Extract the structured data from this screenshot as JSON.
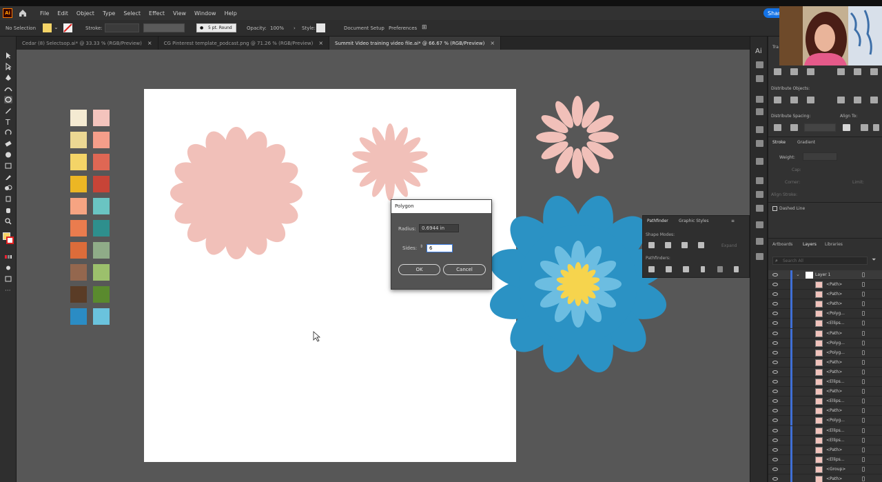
{
  "menubar": {
    "logo": "Ai",
    "items": [
      "File",
      "Edit",
      "Object",
      "Type",
      "Select",
      "Effect",
      "View",
      "Window",
      "Help"
    ],
    "share_label": "Share"
  },
  "controlbar": {
    "selection": "No Selection",
    "stroke_label": "Stroke:",
    "stroke_value": "",
    "brush": "5 pt. Round",
    "opacity_label": "Opacity:",
    "opacity_value": "100%",
    "style_label": "Style:",
    "document_setup": "Document Setup",
    "preferences": "Preferences",
    "fill_color": "#f4d467",
    "stroke_color": "#d8d8d8"
  },
  "tabs": [
    {
      "label": "Cedar (8) Selectsop.ai* @ 33.33 % (RGB/Preview)"
    },
    {
      "label": "CG Pinterest template_podcast.png @ 71.26 % (RGB/Preview)"
    },
    {
      "label": "Summit Video training video file.ai* @ 66.67 % (RGB/Preview)"
    }
  ],
  "swatches": {
    "left": [
      "#f4ead2",
      "#ecd893",
      "#f4d467",
      "#ecb624",
      "#f6a482",
      "#ea7c4e",
      "#dc6c3a",
      "#94674e",
      "#5a3c26",
      "#2b8cc4"
    ],
    "right": [
      "#f4c4bd",
      "#f59e8a",
      "#df6754",
      "#c74437",
      "#6ac4c2",
      "#2e8f8d",
      "#8fac88",
      "#9cc06c",
      "#5a8a2e",
      "#6ac3dd"
    ]
  },
  "colors": {
    "pink": "#f1c0b9",
    "blue_flower": "#2b92c4",
    "light_blue": "#6cbde1",
    "yellow": "#f6d44d"
  },
  "polygon_dialog": {
    "title": "Polygon",
    "radius_label": "Radius:",
    "radius_value": "0.6944 in",
    "sides_label": "Sides:",
    "sides_value": "6",
    "ok_label": "OK",
    "cancel_label": "Cancel"
  },
  "pathfinder": {
    "tab1": "Pathfinder",
    "tab2": "Graphic Styles",
    "shape_modes": "Shape Modes:",
    "pathfinders": "Pathfinders:",
    "expand": "Expand"
  },
  "properties": {
    "header": "Tra",
    "distribute_objects": "Distribute Objects:",
    "distribute_spacing": "Distribute Spacing:",
    "align_to": "Align To:",
    "stroke_tab": "Stroke",
    "gradient_tab": "Gradient",
    "weight_label": "Weight:",
    "cap_label": "Cap:",
    "corner_label": "Corner:",
    "align_stroke": "Align Stroke:",
    "limit_label": "Limit:",
    "dashed_line": "Dashed Line"
  },
  "layers": {
    "tabs": [
      "Artboards",
      "Layers",
      "Libraries"
    ],
    "search_placeholder": "Search All",
    "top_layer": "Layer 1",
    "rows": [
      "<Path>",
      "<Path>",
      "<Path>",
      "<Polyg...",
      "<Ellips...",
      "<Path>",
      "<Polyg...",
      "<Polyg...",
      "<Path>",
      "<Path>",
      "<Ellips...",
      "<Path>",
      "<Ellips...",
      "<Path>",
      "<Polyg...",
      "<Ellips...",
      "<Ellips...",
      "<Path>",
      "<Ellips...",
      "<Group>",
      "<Path>"
    ]
  }
}
